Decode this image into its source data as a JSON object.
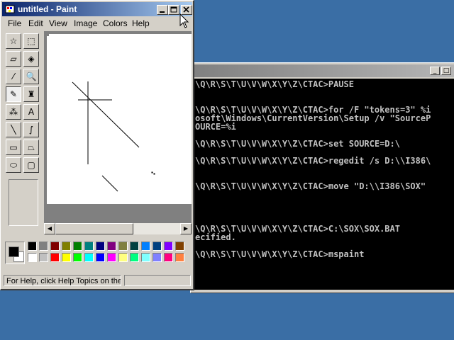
{
  "console": {
    "lines": [
      "\\Q\\R\\S\\T\\U\\V\\W\\X\\Y\\Z\\CTAC>PAUSE",
      "",
      "",
      "\\Q\\R\\S\\T\\U\\V\\W\\X\\Y\\Z\\CTAC>for /F \"tokens=3\" %i",
      "osoft\\Windows\\CurrentVersion\\Setup /v \"SourceP",
      "OURCE=%i",
      "",
      "\\Q\\R\\S\\T\\U\\V\\W\\X\\Y\\Z\\CTAC>set SOURCE=D:\\",
      "",
      "\\Q\\R\\S\\T\\U\\V\\W\\X\\Y\\Z\\CTAC>regedit /s D:\\\\I386\\",
      "",
      "",
      "\\Q\\R\\S\\T\\U\\V\\W\\X\\Y\\Z\\CTAC>move \"D:\\\\I386\\SOX\"",
      "",
      "",
      "",
      "",
      "\\Q\\R\\S\\T\\U\\V\\W\\X\\Y\\Z\\CTAC>C:\\SOX\\SOX.BAT",
      "ecified.",
      "",
      "\\Q\\R\\S\\T\\U\\V\\W\\X\\Y\\Z\\CTAC>mspaint"
    ]
  },
  "paint": {
    "title": "untitled - Paint",
    "menu": [
      "File",
      "Edit",
      "View",
      "Image",
      "Colors",
      "Help"
    ],
    "tools": [
      {
        "name": "free-select-tool",
        "glyph": "☆"
      },
      {
        "name": "select-tool",
        "glyph": "⬚"
      },
      {
        "name": "eraser-tool",
        "glyph": "▱"
      },
      {
        "name": "fill-tool",
        "glyph": "◈"
      },
      {
        "name": "pick-color-tool",
        "glyph": "⁄"
      },
      {
        "name": "magnifier-tool",
        "glyph": "🔍"
      },
      {
        "name": "pencil-tool",
        "glyph": "✎"
      },
      {
        "name": "brush-tool",
        "glyph": "♜"
      },
      {
        "name": "airbrush-tool",
        "glyph": "⁂"
      },
      {
        "name": "text-tool",
        "glyph": "A"
      },
      {
        "name": "line-tool",
        "glyph": "╲"
      },
      {
        "name": "curve-tool",
        "glyph": "∫"
      },
      {
        "name": "rectangle-tool",
        "glyph": "▭"
      },
      {
        "name": "polygon-tool",
        "glyph": "⏢"
      },
      {
        "name": "ellipse-tool",
        "glyph": "⬭"
      },
      {
        "name": "rounded-rectangle-tool",
        "glyph": "▢"
      }
    ],
    "active_tool": "pencil-tool",
    "palette_top": [
      "#000000",
      "#808080",
      "#800000",
      "#808000",
      "#008000",
      "#008080",
      "#000080",
      "#800080",
      "#808040",
      "#004040",
      "#0080ff",
      "#004080",
      "#8000ff",
      "#804000"
    ],
    "palette_bottom": [
      "#ffffff",
      "#c0c0c0",
      "#ff0000",
      "#ffff00",
      "#00ff00",
      "#00ffff",
      "#0000ff",
      "#ff00ff",
      "#ffff80",
      "#00ff80",
      "#80ffff",
      "#8080ff",
      "#ff0080",
      "#ff8040"
    ],
    "foreground_color": "#000000",
    "background_color": "#ffffff",
    "status_text": "For Help, click Help Topics on the"
  }
}
